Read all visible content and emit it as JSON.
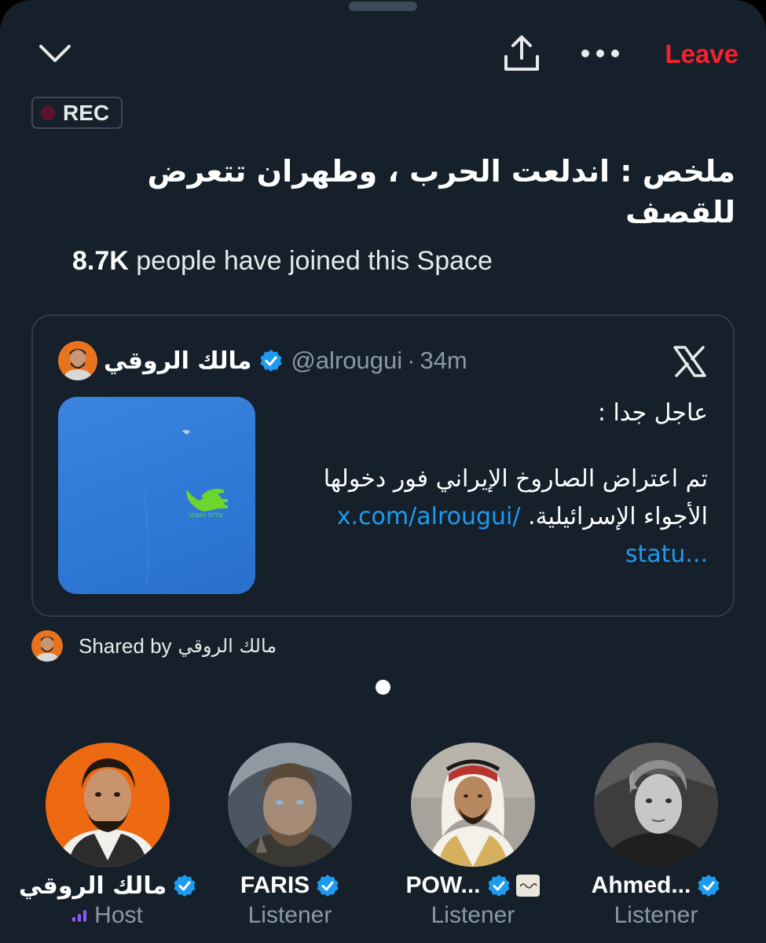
{
  "top_bar": {
    "collapse_icon": "chevron-down-icon",
    "share_icon": "share-upload-icon",
    "more_icon": "more-horizontal-icon",
    "leave_label": "Leave"
  },
  "rec_badge": {
    "label": "REC"
  },
  "space": {
    "title": "ملخص : اندلعت الحرب ، وطهران تتعرض للقصف",
    "joined_count": "8.7K",
    "joined_text": " people have joined this Space"
  },
  "pinned_post": {
    "author_name": "مالك الروقي",
    "handle": "@alrougui",
    "separator": "·",
    "time": "34m",
    "text_line1": "عاجل جدا :",
    "text_line2": "تم اعتراض الصاروخ الإيراني فور دخولها الأجواء الإسرائيلية.",
    "link_part1": "x.com/alrougui/",
    "link_part2": "statu...",
    "media_watermark": "עלית השחר"
  },
  "shared_by": {
    "label": "Shared by",
    "name": "مالك الروقي"
  },
  "participants": [
    {
      "name": "مالك الروقي",
      "role": "Host",
      "verified": true
    },
    {
      "name": "FARIS",
      "role": "Listener",
      "verified": true
    },
    {
      "name": "POW...",
      "role": "Listener",
      "verified": true
    },
    {
      "name": "Ahmed...",
      "role": "Listener",
      "verified": true
    }
  ],
  "colors": {
    "background": "#15202b",
    "leave": "#f4212e",
    "link": "#1d9bf0",
    "verified": "#1d9bf0",
    "secondary_text": "#8b98a5",
    "host_bars": "#8b5cf6"
  }
}
